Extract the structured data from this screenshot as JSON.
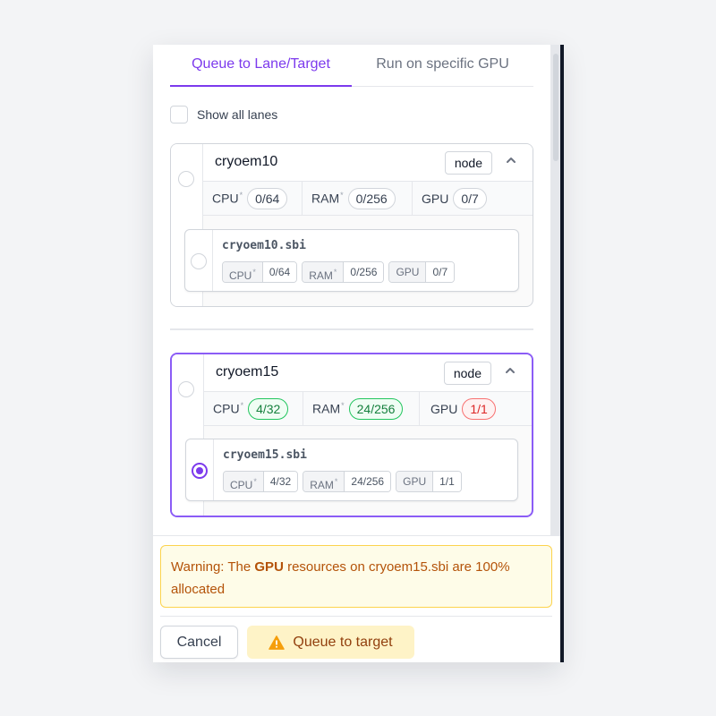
{
  "tabs": [
    {
      "label": "Queue to Lane/Target",
      "active": true
    },
    {
      "label": "Run on specific GPU",
      "active": false
    }
  ],
  "show_all_lanes": {
    "label": "Show all lanes",
    "checked": false
  },
  "lanes": [
    {
      "name": "cryoem10",
      "badge": "node",
      "selected": false,
      "resources": {
        "cpu_label": "CPU",
        "cpu_value": "0/64",
        "ram_label": "RAM",
        "ram_value": "0/256",
        "gpu_label": "GPU",
        "gpu_value": "0/7",
        "star": "*"
      },
      "target": {
        "name": "cryoem10.sbi",
        "selected": false,
        "chips": [
          {
            "label": "CPU",
            "value": "0/64"
          },
          {
            "label": "RAM",
            "value": "0/256"
          },
          {
            "label": "GPU",
            "value": "0/7"
          }
        ]
      }
    },
    {
      "name": "cryoem15",
      "badge": "node",
      "selected": true,
      "resources": {
        "cpu_label": "CPU",
        "cpu_value": "4/32",
        "ram_label": "RAM",
        "ram_value": "24/256",
        "gpu_label": "GPU",
        "gpu_value": "1/1",
        "star": "*"
      },
      "target": {
        "name": "cryoem15.sbi",
        "selected": true,
        "chips": [
          {
            "label": "CPU",
            "value": "4/32"
          },
          {
            "label": "RAM",
            "value": "24/256"
          },
          {
            "label": "GPU",
            "value": "1/1"
          }
        ]
      }
    }
  ],
  "warning": {
    "prefix": "Warning: The ",
    "bold": "GPU",
    "suffix": " resources on cryoem15.sbi are 100% allocated"
  },
  "actions": {
    "cancel_label": "Cancel",
    "queue_label": "Queue to target"
  },
  "colors": {
    "accent": "#7c3aed",
    "warning_bg": "#fefce8",
    "warning_text": "#b45309",
    "ok_green": "#15803d",
    "alert_red": "#dc2626"
  },
  "icons": {
    "chevron": "chevron-up-icon",
    "warning": "warning-triangle-icon"
  }
}
